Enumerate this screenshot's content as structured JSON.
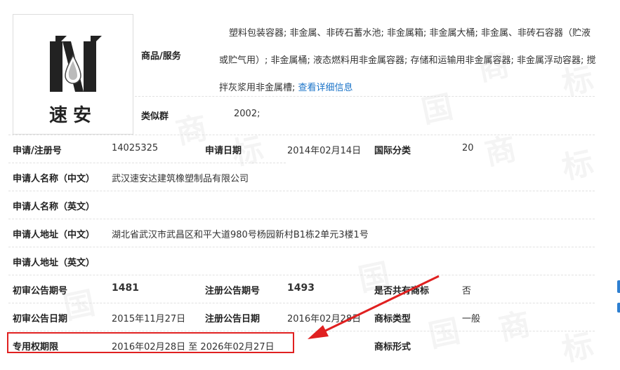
{
  "brand": {
    "logo_text": "速安"
  },
  "watermark": {
    "char1": "国",
    "char2": "商",
    "char3": "标"
  },
  "goods": {
    "label": "商品/服务",
    "text": "塑料包装容器; 非金属、非砖石蓄水池; 非金属箱; 非金属大桶; 非金属、非砖石容器（贮液或贮气用）; 非金属桶; 液态燃料用非金属容器; 存储和运输用非金属容器; 非金属浮动容器; 搅拌灰浆用非金属槽;",
    "link": "查看详细信息"
  },
  "similar_group": {
    "label": "类似群",
    "value": "2002;"
  },
  "fields": {
    "reg_no": {
      "label": "申请/注册号",
      "value": "14025325"
    },
    "apply_date": {
      "label": "申请日期",
      "value": "2014年02月14日"
    },
    "intl_class": {
      "label": "国际分类",
      "value": "20"
    },
    "applicant_cn": {
      "label": "申请人名称（中文）",
      "value": "武汉速安达建筑橡塑制品有限公司"
    },
    "applicant_en": {
      "label": "申请人名称（英文）",
      "value": ""
    },
    "address_cn": {
      "label": "申请人地址（中文）",
      "value": "湖北省武汉市武昌区和平大道980号杨园新村B1栋2单元3楼1号"
    },
    "address_en": {
      "label": "申请人地址（英文）",
      "value": ""
    },
    "prelim_no": {
      "label": "初审公告期号",
      "value": "1481"
    },
    "reg_pub_no": {
      "label": "注册公告期号",
      "value": "1493"
    },
    "shared": {
      "label": "是否共有商标",
      "value": "否"
    },
    "prelim_date": {
      "label": "初审公告日期",
      "value": "2015年11月27日"
    },
    "reg_pub_date": {
      "label": "注册公告日期",
      "value": "2016年02月28日"
    },
    "tm_type": {
      "label": "商标类型",
      "value": "一般"
    },
    "exclusive_period": {
      "label": "专用权期限",
      "value": "2016年02月28日 至 2026年02月27日"
    },
    "tm_form": {
      "label": "商标形式",
      "value": ""
    }
  },
  "colors": {
    "accent": "#1a73c8",
    "highlight": "#e02020",
    "label": "#222222"
  }
}
